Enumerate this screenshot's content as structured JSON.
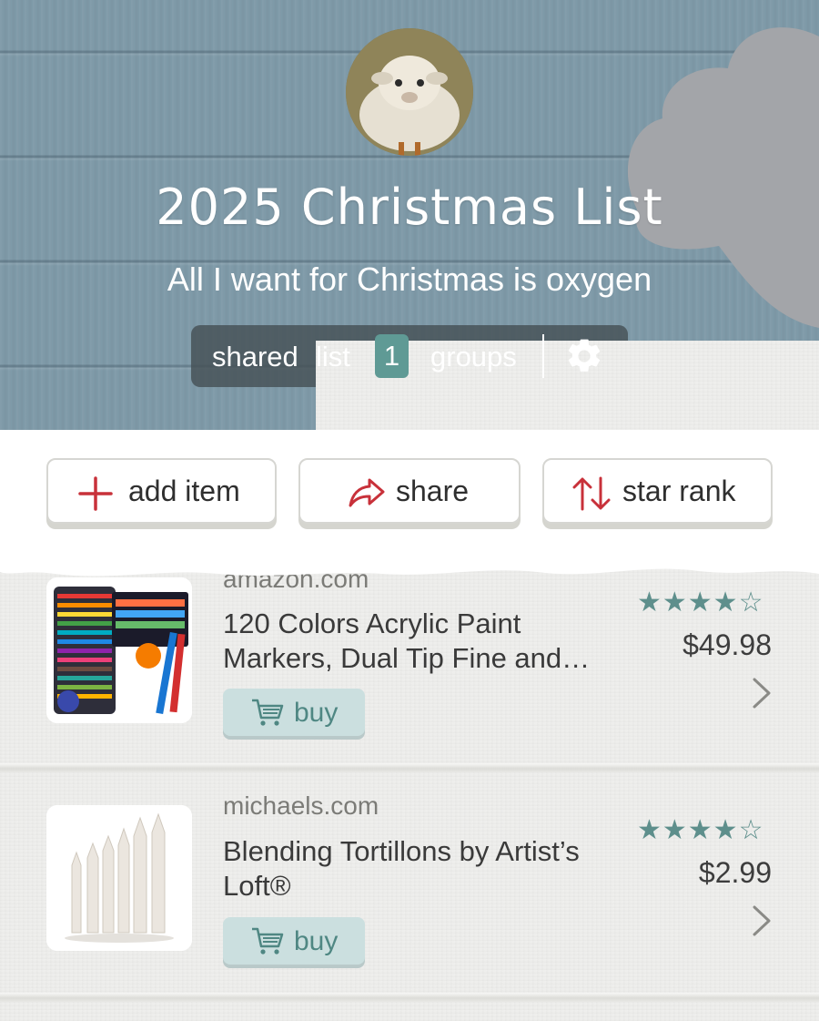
{
  "header": {
    "title": "2025 Christmas List",
    "subtitle": "All I want for Christmas is oxygen",
    "avatar_alt": "sheep",
    "pill": {
      "shared_label": "shared",
      "list_label": "list",
      "groups_count": "1",
      "groups_label": "groups",
      "settings_icon": "gear-icon"
    }
  },
  "toolbar": {
    "add_label": "add item",
    "share_label": "share",
    "rank_label": "star rank"
  },
  "items": [
    {
      "domain": "amazon.com",
      "name": "120 Colors Acrylic Paint Markers, Dual Tip Fine and…",
      "rating": 4,
      "rating_max": 5,
      "stars_text": "★★★★☆",
      "price": "$49.98",
      "buy_label": "buy"
    },
    {
      "domain": "michaels.com",
      "name": "Blending Tortillons by Artist’s Loft®",
      "rating": 4,
      "rating_max": 5,
      "stars_text": "★★★★☆",
      "price": "$2.99",
      "buy_label": "buy"
    }
  ],
  "colors": {
    "accent_red": "#c8313a",
    "teal": "#5e8f8c",
    "header_blue": "#7f9aa8"
  }
}
